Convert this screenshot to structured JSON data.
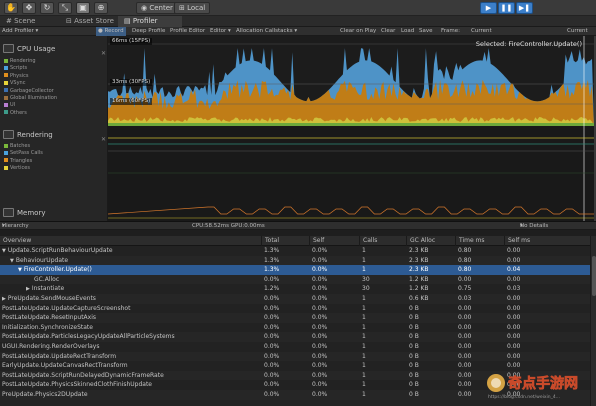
{
  "toolbar": {
    "center_label": "Center",
    "local_label": "Local",
    "tool_icons": [
      "hand-icon",
      "move-icon",
      "rotate-icon",
      "scale-icon",
      "rect-tool-icon"
    ],
    "play_icons": [
      "play-icon",
      "pause-icon",
      "step-icon"
    ]
  },
  "tabs": [
    {
      "label": "Scene",
      "icon": "scene-icon"
    },
    {
      "label": "Asset Store",
      "icon": "asset-store-icon"
    },
    {
      "label": "Profiler",
      "icon": "profiler-icon",
      "active": true
    }
  ],
  "profiler_toolbar": {
    "add_profiler": "Add Profiler",
    "record": "Record",
    "deep_profile": "Deep Profile",
    "profile_editor": "Profile Editor",
    "editor": "Editor",
    "allocation_callstacks": "Allocation Callstacks",
    "clear_on_play": "Clear on Play",
    "clear": "Clear",
    "load": "Load",
    "save": "Save",
    "frame": "Frame:",
    "current_btn": "Current",
    "current_label": "Current"
  },
  "cpu_section": {
    "title": "CPU Usage",
    "legend": [
      {
        "label": "Rendering",
        "color": "#7ab83b"
      },
      {
        "label": "Scripts",
        "color": "#4aa3dd"
      },
      {
        "label": "Physics",
        "color": "#e08f1d"
      },
      {
        "label": "VSync",
        "color": "#e6d43a"
      },
      {
        "label": "GarbageCollector",
        "color": "#3b6fb0"
      },
      {
        "label": "Global Illumination",
        "color": "#9b6f3d"
      },
      {
        "label": "UI",
        "color": "#b97fd1"
      },
      {
        "label": "Others",
        "color": "#3d9c8a"
      }
    ]
  },
  "rendering_section": {
    "title": "Rendering",
    "legend": [
      {
        "label": "Batches",
        "color": "#7ab83b"
      },
      {
        "label": "SetPass Calls",
        "color": "#4aa3dd"
      },
      {
        "label": "Triangles",
        "color": "#e08f1d"
      },
      {
        "label": "Vertices",
        "color": "#e6d43a"
      }
    ]
  },
  "memory_section": {
    "title": "Memory"
  },
  "graph": {
    "marker_66": "66ms (15FPS)",
    "marker_33": "33ms (30FPS)",
    "marker_16": "16ms (60FPS)",
    "selected_label": "Selected: FireController.Update()",
    "colors": {
      "scripts": "#4e93c7",
      "physics": "#c07d17",
      "vsync": "#cfc03a",
      "rendering": "#6ea83a",
      "others": "#2f8a77",
      "line_yellow": "#cdbb31",
      "line_orange": "#d4772b"
    }
  },
  "hierarchy_bar": {
    "view": "Hierarchy",
    "stats": "CPU:58.52ms   GPU:0.00ms",
    "no_details": "No Details"
  },
  "columns": [
    "Overview",
    "Total",
    "Self",
    "Calls",
    "GC Alloc",
    "Time ms",
    "Self ms"
  ],
  "rows": [
    {
      "name": "Update.ScriptRunBehaviourUpdate",
      "indent": 0,
      "arrow": "▼",
      "total": "1.3%",
      "self": "0.0%",
      "calls": "1",
      "gc": "2.3 KB",
      "time": "0.80",
      "selfms": "0.00"
    },
    {
      "name": "BehaviourUpdate",
      "indent": 1,
      "arrow": "▼",
      "total": "1.3%",
      "self": "0.0%",
      "calls": "1",
      "gc": "2.3 KB",
      "time": "0.80",
      "selfms": "0.00"
    },
    {
      "name": "FireController.Update()",
      "indent": 2,
      "arrow": "▼",
      "total": "1.3%",
      "self": "0.0%",
      "calls": "1",
      "gc": "2.3 KB",
      "time": "0.80",
      "selfms": "0.04",
      "selected": true
    },
    {
      "name": "GC.Alloc",
      "indent": 4,
      "arrow": "",
      "total": "0.0%",
      "self": "0.0%",
      "calls": "30",
      "gc": "1.2 KB",
      "time": "0.00",
      "selfms": "0.00"
    },
    {
      "name": "Instantiate",
      "indent": 3,
      "arrow": "▶",
      "total": "1.2%",
      "self": "0.0%",
      "calls": "30",
      "gc": "1.2 KB",
      "time": "0.75",
      "selfms": "0.03"
    },
    {
      "name": "PreUpdate.SendMouseEvents",
      "indent": 0,
      "arrow": "▶",
      "total": "0.0%",
      "self": "0.0%",
      "calls": "1",
      "gc": "0.6 KB",
      "time": "0.03",
      "selfms": "0.00"
    },
    {
      "name": "PostLateUpdate.UpdateCaptureScreenshot",
      "indent": 0,
      "arrow": "",
      "total": "0.0%",
      "self": "0.0%",
      "calls": "1",
      "gc": "0 B",
      "time": "0.00",
      "selfms": "0.00"
    },
    {
      "name": "PostLateUpdate.ResetInputAxis",
      "indent": 0,
      "arrow": "",
      "total": "0.0%",
      "self": "0.0%",
      "calls": "1",
      "gc": "0 B",
      "time": "0.00",
      "selfms": "0.00"
    },
    {
      "name": "Initialization.SynchronizeState",
      "indent": 0,
      "arrow": "",
      "total": "0.0%",
      "self": "0.0%",
      "calls": "1",
      "gc": "0 B",
      "time": "0.00",
      "selfms": "0.00"
    },
    {
      "name": "PostLateUpdate.ParticlesLegacyUpdateAllParticleSystems",
      "indent": 0,
      "arrow": "",
      "total": "0.0%",
      "self": "0.0%",
      "calls": "1",
      "gc": "0 B",
      "time": "0.00",
      "selfms": "0.00"
    },
    {
      "name": "UGUI.Rendering.RenderOverlays",
      "indent": 0,
      "arrow": "",
      "total": "0.0%",
      "self": "0.0%",
      "calls": "1",
      "gc": "0 B",
      "time": "0.00",
      "selfms": "0.00"
    },
    {
      "name": "PostLateUpdate.UpdateRectTransform",
      "indent": 0,
      "arrow": "",
      "total": "0.0%",
      "self": "0.0%",
      "calls": "1",
      "gc": "0 B",
      "time": "0.00",
      "selfms": "0.00"
    },
    {
      "name": "EarlyUpdate.UpdateCanvasRectTransform",
      "indent": 0,
      "arrow": "",
      "total": "0.0%",
      "self": "0.0%",
      "calls": "1",
      "gc": "0 B",
      "time": "0.00",
      "selfms": "0.00"
    },
    {
      "name": "PostLateUpdate.ScriptRunDelayedDynamicFrameRate",
      "indent": 0,
      "arrow": "",
      "total": "0.0%",
      "self": "0.0%",
      "calls": "1",
      "gc": "0 B",
      "time": "0.00",
      "selfms": "0.00"
    },
    {
      "name": "PostLateUpdate.PhysicsSkinnedClothFinishUpdate",
      "indent": 0,
      "arrow": "",
      "total": "0.0%",
      "self": "0.0%",
      "calls": "1",
      "gc": "0 B",
      "time": "0.00",
      "selfms": "0.00"
    },
    {
      "name": "PreUpdate.Physics2DUpdate",
      "indent": 0,
      "arrow": "",
      "total": "0.0%",
      "self": "0.0%",
      "calls": "1",
      "gc": "0 B",
      "time": "0.00",
      "selfms": "0.00"
    }
  ],
  "watermark": {
    "logo": "奇点手游网",
    "url": "https://blog.csdn.net/weixin_4..."
  }
}
